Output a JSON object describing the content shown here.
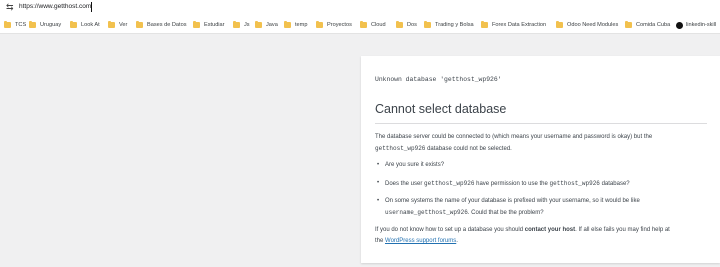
{
  "addressbar": {
    "url": "https://www.getthost.com"
  },
  "bookmarks": [
    {
      "label": "TCS",
      "icon": "folder-icon"
    },
    {
      "label": "Uruguay",
      "icon": "folder-icon"
    },
    {
      "label": "Look At",
      "icon": "folder-icon"
    },
    {
      "label": "Ver",
      "icon": "folder-icon"
    },
    {
      "label": "Bases de Datos",
      "icon": "folder-icon"
    },
    {
      "label": "Estudiar",
      "icon": "folder-icon"
    },
    {
      "label": "Js",
      "icon": "folder-icon"
    },
    {
      "label": "Java",
      "icon": "folder-icon"
    },
    {
      "label": "temp",
      "icon": "folder-icon"
    },
    {
      "label": "Proyectos",
      "icon": "folder-icon"
    },
    {
      "label": "Cloud",
      "icon": "folder-icon"
    },
    {
      "label": "Dos",
      "icon": "folder-icon"
    },
    {
      "label": "Trading y Bolsa",
      "icon": "folder-icon"
    },
    {
      "label": "Forex Data Extraction",
      "icon": "folder-icon"
    },
    {
      "label": "Odoo Need Modules",
      "icon": "folder-icon"
    },
    {
      "label": "Comida Cuba",
      "icon": "folder-icon"
    },
    {
      "label": "linkedin-skill",
      "icon": "github-icon"
    }
  ],
  "error": {
    "message": "Unknown database 'getthost_wp926'",
    "heading": "Cannot select database",
    "intro_1": "The database server could be connected to (which means your username and password is okay) but the",
    "intro_db": "getthost_wp926",
    "intro_2": " database could not be selected.",
    "item1": "Are you sure it exists?",
    "item2_a": "Does the user ",
    "item2_user": "getthost_wp926",
    "item2_b": " have permission to use the ",
    "item2_db": "getthost_wp926",
    "item2_c": " database?",
    "item3_a": "On some systems the name of your database is prefixed with your username, so it would be like",
    "item3_code": "username_getthost_wp926",
    "item3_b": ". Could that be the problem?",
    "footer_a": "If you do not know how to set up a database you should ",
    "footer_strong": "contact your host",
    "footer_b": ". If all else fails you may find help at",
    "footer_c": "the ",
    "footer_link": "WordPress support forums",
    "footer_d": "."
  },
  "colors": {
    "link": "#2271b1",
    "text": "#3c434a",
    "background": "#f0f0f1"
  }
}
